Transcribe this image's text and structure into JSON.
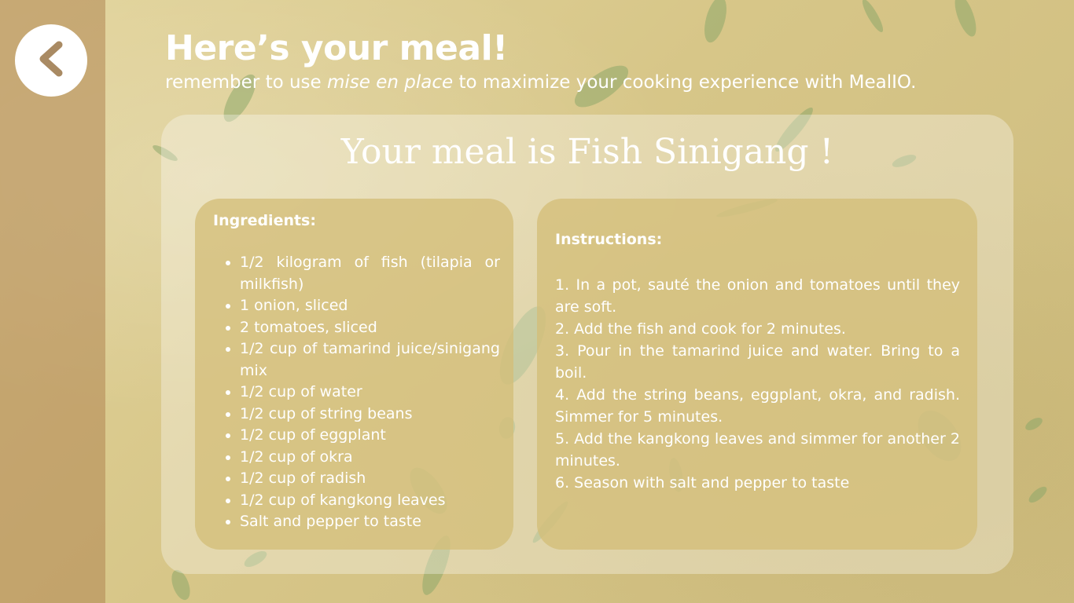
{
  "header": {
    "title": "Here’s your meal!",
    "subtitle_before": "remember to use ",
    "subtitle_em": "mise en place",
    "subtitle_after": " to maximize your cooking experience with MealIO."
  },
  "back_icon": "chevron-left-icon",
  "meal": {
    "title": "Your meal is Fish Sinigang !"
  },
  "ingredients": {
    "heading": "Ingredients:",
    "items": [
      "1/2 kilogram of fish (tilapia or milkfish)",
      "1 onion, sliced",
      "2 tomatoes, sliced",
      "1/2 cup of tamarind juice/sinigang mix",
      "1/2 cup of water",
      "1/2 cup of string beans",
      "1/2 cup of eggplant",
      "1/2 cup of okra",
      "1/2 cup of radish",
      "1/2 cup of kangkong leaves",
      "Salt and pepper to taste"
    ]
  },
  "instructions": {
    "heading": "Instructions:",
    "steps": [
      "1. In a pot, sauté the onion and tomatoes until they are soft.",
      "2. Add the fish and cook for 2 minutes.",
      "3. Pour in the tamarind juice and water. Bring to a boil.",
      "4. Add the string beans, eggplant, okra, and radish. Simmer for 5 minutes.",
      "5. Add the kangkong leaves and simmer for another 2 minutes.",
      "6. Season with salt and pepper to taste"
    ]
  },
  "colors": {
    "background": "#d9c98e",
    "sidebar": "#b08552",
    "panel": "#d4be78",
    "text": "#ffffff"
  }
}
